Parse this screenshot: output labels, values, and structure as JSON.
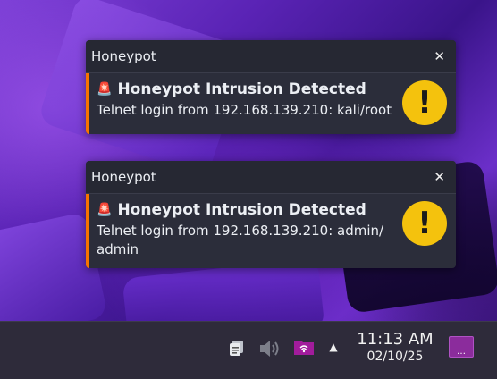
{
  "notifications": [
    {
      "app": "Honeypot",
      "close_label": "✕",
      "title_icon": "🚨",
      "title": "Honeypot Intrusion Detected",
      "message": "Telnet login from 192.168.139.210: kali/root",
      "icon": "warning-icon",
      "icon_glyph": "!",
      "accent": "#f67400"
    },
    {
      "app": "Honeypot",
      "close_label": "✕",
      "title_icon": "🚨",
      "title": "Honeypot Intrusion Detected",
      "message": "Telnet login from 192.168.139.210: admin/ admin",
      "icon": "warning-icon",
      "icon_glyph": "!",
      "accent": "#f67400"
    }
  ],
  "taskbar": {
    "tray": [
      "clipboard-icon",
      "volume-icon",
      "network-icon",
      "expand-tray-icon"
    ],
    "time": "11:13 AM",
    "date": "02/10/25",
    "show_desktop_icon": "show-desktop-icon"
  }
}
